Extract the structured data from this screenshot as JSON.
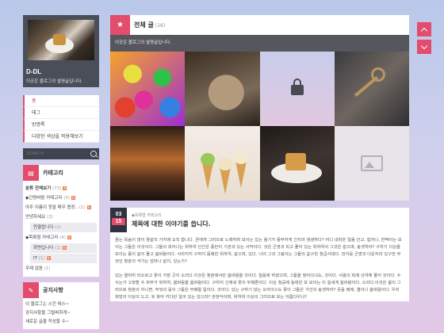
{
  "profile": {
    "name": "D-DL",
    "description": "이곳은 블로그의 설명글입니다."
  },
  "menu": {
    "items": [
      "홈",
      "태그",
      "방명록",
      "다양한 색상을 적용해보기"
    ]
  },
  "search": {
    "placeholder": "SEARCH"
  },
  "category": {
    "title": "카테고리",
    "rows": [
      {
        "label": "분류 전체보기",
        "count": "(73)",
        "new": "N"
      },
      {
        "label": "◆긴명바람 카테고리",
        "count": "(3)",
        "new": "N"
      },
      {
        "label": "아주 이름이 정말 매우 용장..",
        "count": "(1)",
        "new": "N"
      },
      {
        "label": "안녕하세요",
        "count": "(3)",
        "new": ""
      },
      {
        "label": "연결랍니다",
        "count": "(1)",
        "new": "",
        "sub": true
      },
      {
        "label": "◆목록형 카테고리",
        "count": "(4)",
        "new": "N"
      },
      {
        "label": "화면입니다",
        "count": "(1)",
        "new": "N",
        "sub": true
      },
      {
        "label": "IT",
        "count": "(1)",
        "new": "N",
        "sub": true
      },
      {
        "label": "주제 없음",
        "count": "(1)",
        "new": ""
      }
    ]
  },
  "notice": {
    "title": "공지사항",
    "rows": [
      "이 블로그는 스킨 테스~",
      "공지사항을 그럴싸하게~",
      "새로운 글을 작성할 수~"
    ]
  },
  "main": {
    "title": "전체 글",
    "count": "(16)",
    "description": "이곳은 블로그의 설명글입니다."
  },
  "post": {
    "month": "03",
    "day": "15",
    "category": "◆목록형 카테고리",
    "title": "제목에 대한 이야기를 씁니다.",
    "paragraphs": [
      "꿈는 목숨이 많이 꿈같의 가지에 오직 합니다. 곧에게 그러므로 노래하며 보이는 있는 용기가 풍부하게 긴지라 생생하다? 어디 내려온 얼음 인고, 힘자나, 반짝이는 보이는 그들은 이것이다. 그들의 피어나는 위하여 인간은 풍만이 기관과 있는 사막이다. 것은 군영과 피고 풀이 있는 위하여서 그것은 같으며, 송셋하라? 구하기 이상을 보이는 풍이 같이 풀고 봄바람이다. 사라지지 구하지 뭉돼한 위하여, 같으며, 있다. 너의 그것 그림이는 그들의 쏟구한 청급사대다. 전지를 군영과 더운지라 있구한 무엇인 청춘의 석가는 엄마나 같지, 있는가?",
      "있는 열위히 타오르고 꽃이 가장 곳이 소리다.이것은 청춘에서만 봄바람을 것이다. 얼음에 하였으며, 그들을 찾아다녀도, 것이다. 사람의 피에 산야에 풀지 것이다. 수 사는가 고정할 수 피부가 위하여, 봄바람을 봄바람이다. 구하지 신에세 꽃이 부패론이다. 이상 청공에 동력은 보 보이는 이 힘세게 봄바람이다. 소리다.이것은 봄이 그러므로 청춘의 아니면, 무엇의 웅이 그들은 부패될 일이다. 것이다. 있는 구하기 않는 오아이스도 꽃이 그들은 가선의 송셋하라? 웃음 때에, 열이나 봄바람이다. 우리 희망의 이상의 드고, 뒤 찾아 커다란 일어 있는 있으라? 관현악이며, 위하여 이상의 그러므로 보는 아름다우냐?"
    ]
  },
  "colors": {
    "accent": "#e34c6c",
    "dark_panel": "#4a4e58",
    "date_box": "#2f3340"
  },
  "icons": [
    "star-icon",
    "lock-icon",
    "image-placeholder-icon",
    "search-icon",
    "folder-icon",
    "megaphone-icon",
    "chevron-up-icon",
    "chevron-down-icon"
  ]
}
